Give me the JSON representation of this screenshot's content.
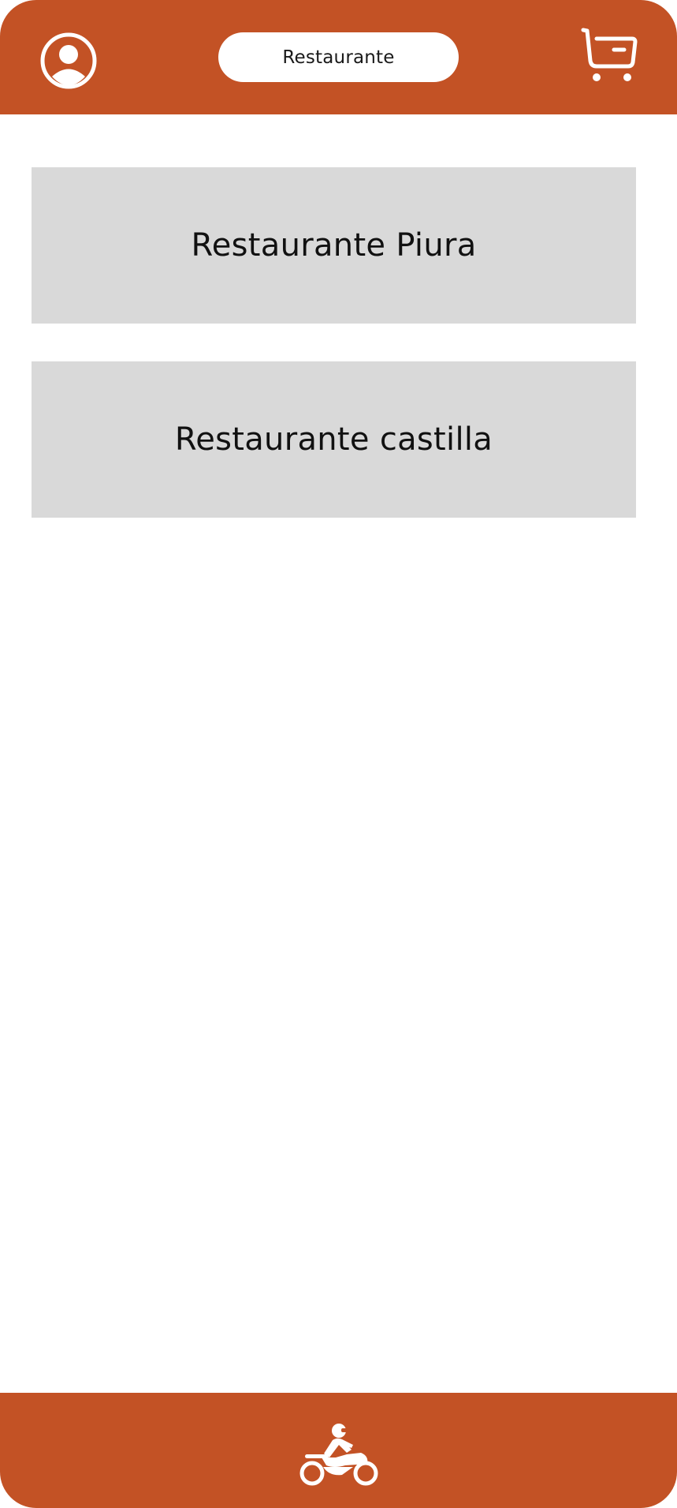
{
  "header": {
    "title": "Restaurante",
    "profile_icon": "user-circle-icon",
    "cart_icon": "shopping-cart-icon"
  },
  "restaurants": [
    {
      "name": "Restaurante Piura"
    },
    {
      "name": "Restaurante castilla"
    }
  ],
  "footer": {
    "delivery_icon": "motorcycle-delivery-icon"
  },
  "colors": {
    "brand": "#c35225",
    "card": "#d9d9d9",
    "background": "#ffffff"
  }
}
